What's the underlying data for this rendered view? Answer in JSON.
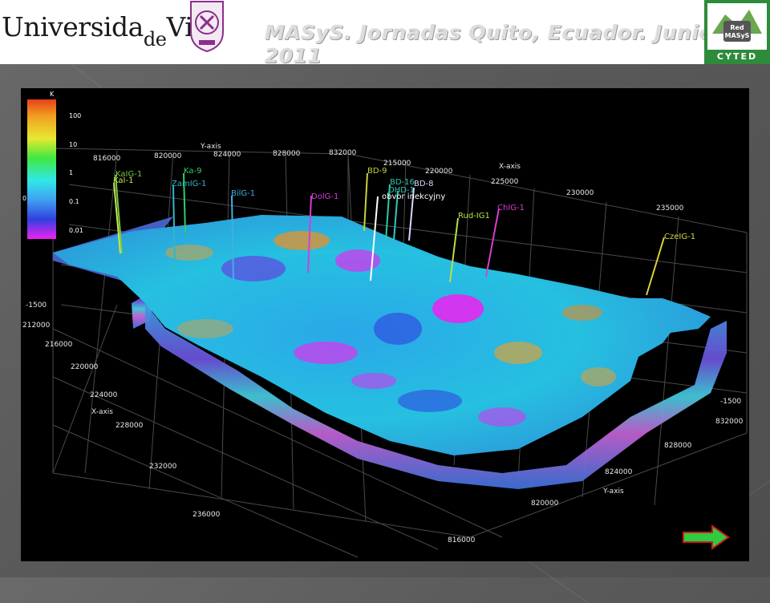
{
  "header": {
    "university_main": "Universida",
    "university_de": "de",
    "university_end": "Vigo",
    "conference_title": "MASyS. Jornadas Quito, Ecuador. Junio 2011",
    "logo_right_small": "Red",
    "logo_right_name": "MASyS",
    "logo_right_label": "CYTED"
  },
  "visualization": {
    "colorbar_title": "K",
    "colorbar_ticks": [
      "100",
      "10",
      "1",
      "0.1",
      "0.01"
    ],
    "colorbar_side_label": "0",
    "y_axis_title_top": "Y-axis",
    "y_axis_top_ticks": [
      "816000",
      "820000",
      "824000",
      "828000",
      "832000"
    ],
    "x_axis_title_top": "X-axis",
    "x_axis_top_ticks": [
      "215000",
      "220000",
      "225000",
      "230000",
      "235000"
    ],
    "x_axis_title_left": "X-axis",
    "x_axis_left_ticks": [
      "212000",
      "216000",
      "220000",
      "224000",
      "228000",
      "232000",
      "236000"
    ],
    "y_axis_title_bottom": "Y-axis",
    "y_axis_bottom_ticks": [
      "832000",
      "828000",
      "824000",
      "820000",
      "816000"
    ],
    "z_label_left": "-1500",
    "z_label_right": "-1500",
    "annotation": "obvor inekcyjny",
    "wells": [
      {
        "name": "KaIG-1",
        "color": "#7ac943"
      },
      {
        "name": "KaI-1",
        "color": "#c8e64a"
      },
      {
        "name": "Ka-9",
        "color": "#33cc66"
      },
      {
        "name": "ZamIG-1",
        "color": "#2fb8c8"
      },
      {
        "name": "BilG-1",
        "color": "#3fb0e6"
      },
      {
        "name": "DolG-1",
        "color": "#d23fd8"
      },
      {
        "name": "BD-9",
        "color": "#c8d23a"
      },
      {
        "name": "BD-16",
        "color": "#2fc8a8"
      },
      {
        "name": "BD-8",
        "color": "#d8d8ff"
      },
      {
        "name": "DHD-1",
        "color": "#2fc8c0"
      },
      {
        "name": "Rud-IG1",
        "color": "#b8e04a"
      },
      {
        "name": "ChIG-1",
        "color": "#d83fd0"
      },
      {
        "name": "CzeIG-1",
        "color": "#d8d23a"
      }
    ]
  }
}
